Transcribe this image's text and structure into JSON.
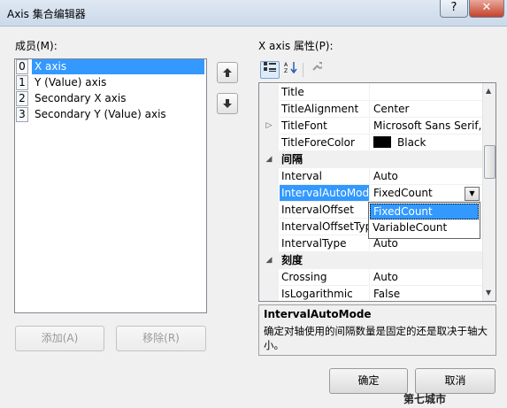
{
  "window": {
    "title": "Axis 集合编辑器",
    "title_blurred": "",
    "help_label": "?",
    "close_label": "✕"
  },
  "members": {
    "label": "成员(M):",
    "items": [
      {
        "index": "0",
        "label": "X axis",
        "selected": true
      },
      {
        "index": "1",
        "label": "Y (Value) axis",
        "selected": false
      },
      {
        "index": "2",
        "label": "Secondary X axis",
        "selected": false
      },
      {
        "index": "3",
        "label": "Secondary Y (Value) axis",
        "selected": false
      }
    ],
    "move_up_icon": "arrow-up-icon",
    "move_down_icon": "arrow-down-icon",
    "add_label": "添加(A)",
    "remove_label": "移除(R)"
  },
  "properties": {
    "label": "X axis 属性(P):",
    "toolbar": {
      "categorized_icon": "categorized-icon",
      "alphabetical_icon": "alphabetical-sort-icon",
      "property_pages_icon": "wrench-icon"
    },
    "rows": [
      {
        "type": "prop",
        "name": "Title",
        "value": ""
      },
      {
        "type": "prop",
        "name": "TitleAlignment",
        "value": "Center"
      },
      {
        "type": "prop",
        "name": "TitleFont",
        "value": "Microsoft Sans Serif,",
        "expander": "▷"
      },
      {
        "type": "prop",
        "name": "TitleForeColor",
        "value": "Black",
        "swatch": "#000000"
      },
      {
        "type": "category",
        "name": "间隔",
        "expander": "◢"
      },
      {
        "type": "prop",
        "name": "Interval",
        "value": "Auto"
      },
      {
        "type": "prop",
        "name": "IntervalAutoMode",
        "value": "FixedCount",
        "selected": true
      },
      {
        "type": "prop",
        "name": "IntervalOffset",
        "value": ""
      },
      {
        "type": "prop",
        "name": "IntervalOffsetType",
        "value": ""
      },
      {
        "type": "prop",
        "name": "IntervalType",
        "value": "Auto"
      },
      {
        "type": "category",
        "name": "刻度",
        "expander": "◢"
      },
      {
        "type": "prop",
        "name": "Crossing",
        "value": "Auto"
      },
      {
        "type": "prop",
        "name": "IsLogarithmic",
        "value": "False"
      }
    ],
    "dropdown_options": [
      "FixedCount",
      "VariableCount"
    ],
    "dropdown_selected": "FixedCount",
    "description": {
      "title": "IntervalAutoMode",
      "text": "确定对轴使用的间隔数量是固定的还是取决于轴大小。"
    }
  },
  "footer": {
    "ok_label": "确定",
    "cancel_label": "取消"
  },
  "watermark": "第七城市",
  "colors": {
    "selection": "#3399ff",
    "window_bg": "#f0f0f0"
  }
}
